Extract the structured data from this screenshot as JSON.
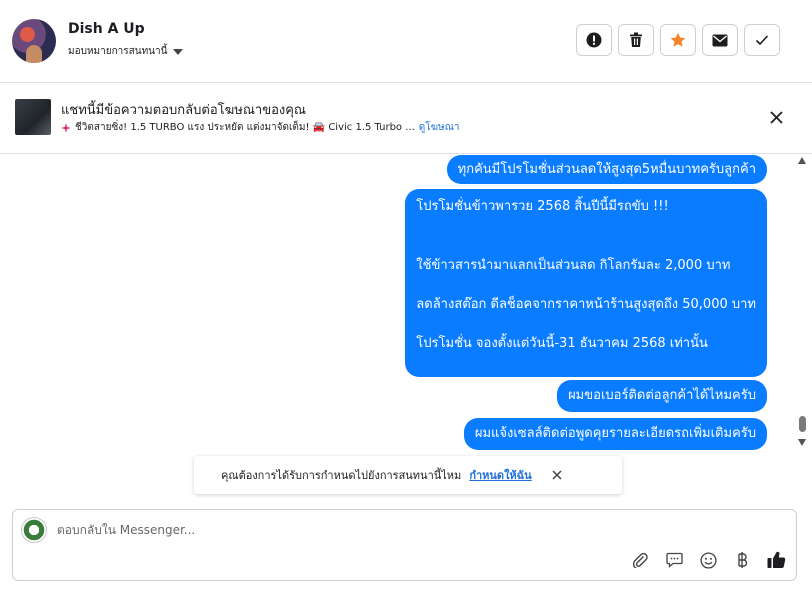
{
  "header": {
    "contact_name": "Dish A Up",
    "assign_label": "มอบหมายการสนทนานี้"
  },
  "actions": {
    "icons": [
      "alert-icon",
      "trash-icon",
      "star-icon",
      "mail-icon",
      "check-icon"
    ]
  },
  "ad_banner": {
    "title": "แชทนี้มีข้อความตอบกลับต่อโฆษณาของคุณ",
    "subtitle": "ชีวิตสายซิ่ง! 1.5 TURBO แรง ประหยัด แต่งมาจัดเต็ม! 🚘 Civic 1.5 Turbo ...",
    "link_label": "ดูโฆษณา"
  },
  "messages": [
    {
      "text": "ทุกคันมีโปรโมชั่นส่วนลดให้สูงสุด5หมื่นบาทครับลูกค้า"
    },
    {
      "lines": [
        "โปรโมชั่นข้าวพารวย 2568 สิ้นปีนี้มีรถขับ !!!",
        "",
        "",
        "ใช้ข้าวสารนำมาแลกเป็นส่วนลด กิโลกรัมละ 2,000 บาท",
        "",
        "ลดล้างสต๊อก ดีลช็อคจากราคาหน้าร้านสูงสุดถึง 50,000 บาท",
        "",
        "โปรโมชั่น  จองตั้งแต่วันนี้-31 ธันวาคม 2568 เท่านั้น"
      ]
    },
    {
      "text": "ผมขอเบอร์ติดต่อลูกค้าได้ไหมครับ"
    },
    {
      "text": "ผมแจ้งเซลล์ติดต่อพูดคุยรายละเอียดรถเพิ่มเติมครับ"
    }
  ],
  "assign_prompt": {
    "text": "คุณต้องการได้รับการกำหนดไปยังการสนทนานี้ไหม",
    "link_label": "กำหนดให้ฉัน"
  },
  "composer": {
    "placeholder": "ตอบกลับใน Messenger...",
    "tools": [
      "attach-icon",
      "saved-reply-icon",
      "emoji-icon",
      "baht-icon",
      "thumbs-up-icon"
    ]
  },
  "colors": {
    "bubble": "#0a7cff",
    "link": "#216fdb",
    "star": "#f5832b"
  }
}
